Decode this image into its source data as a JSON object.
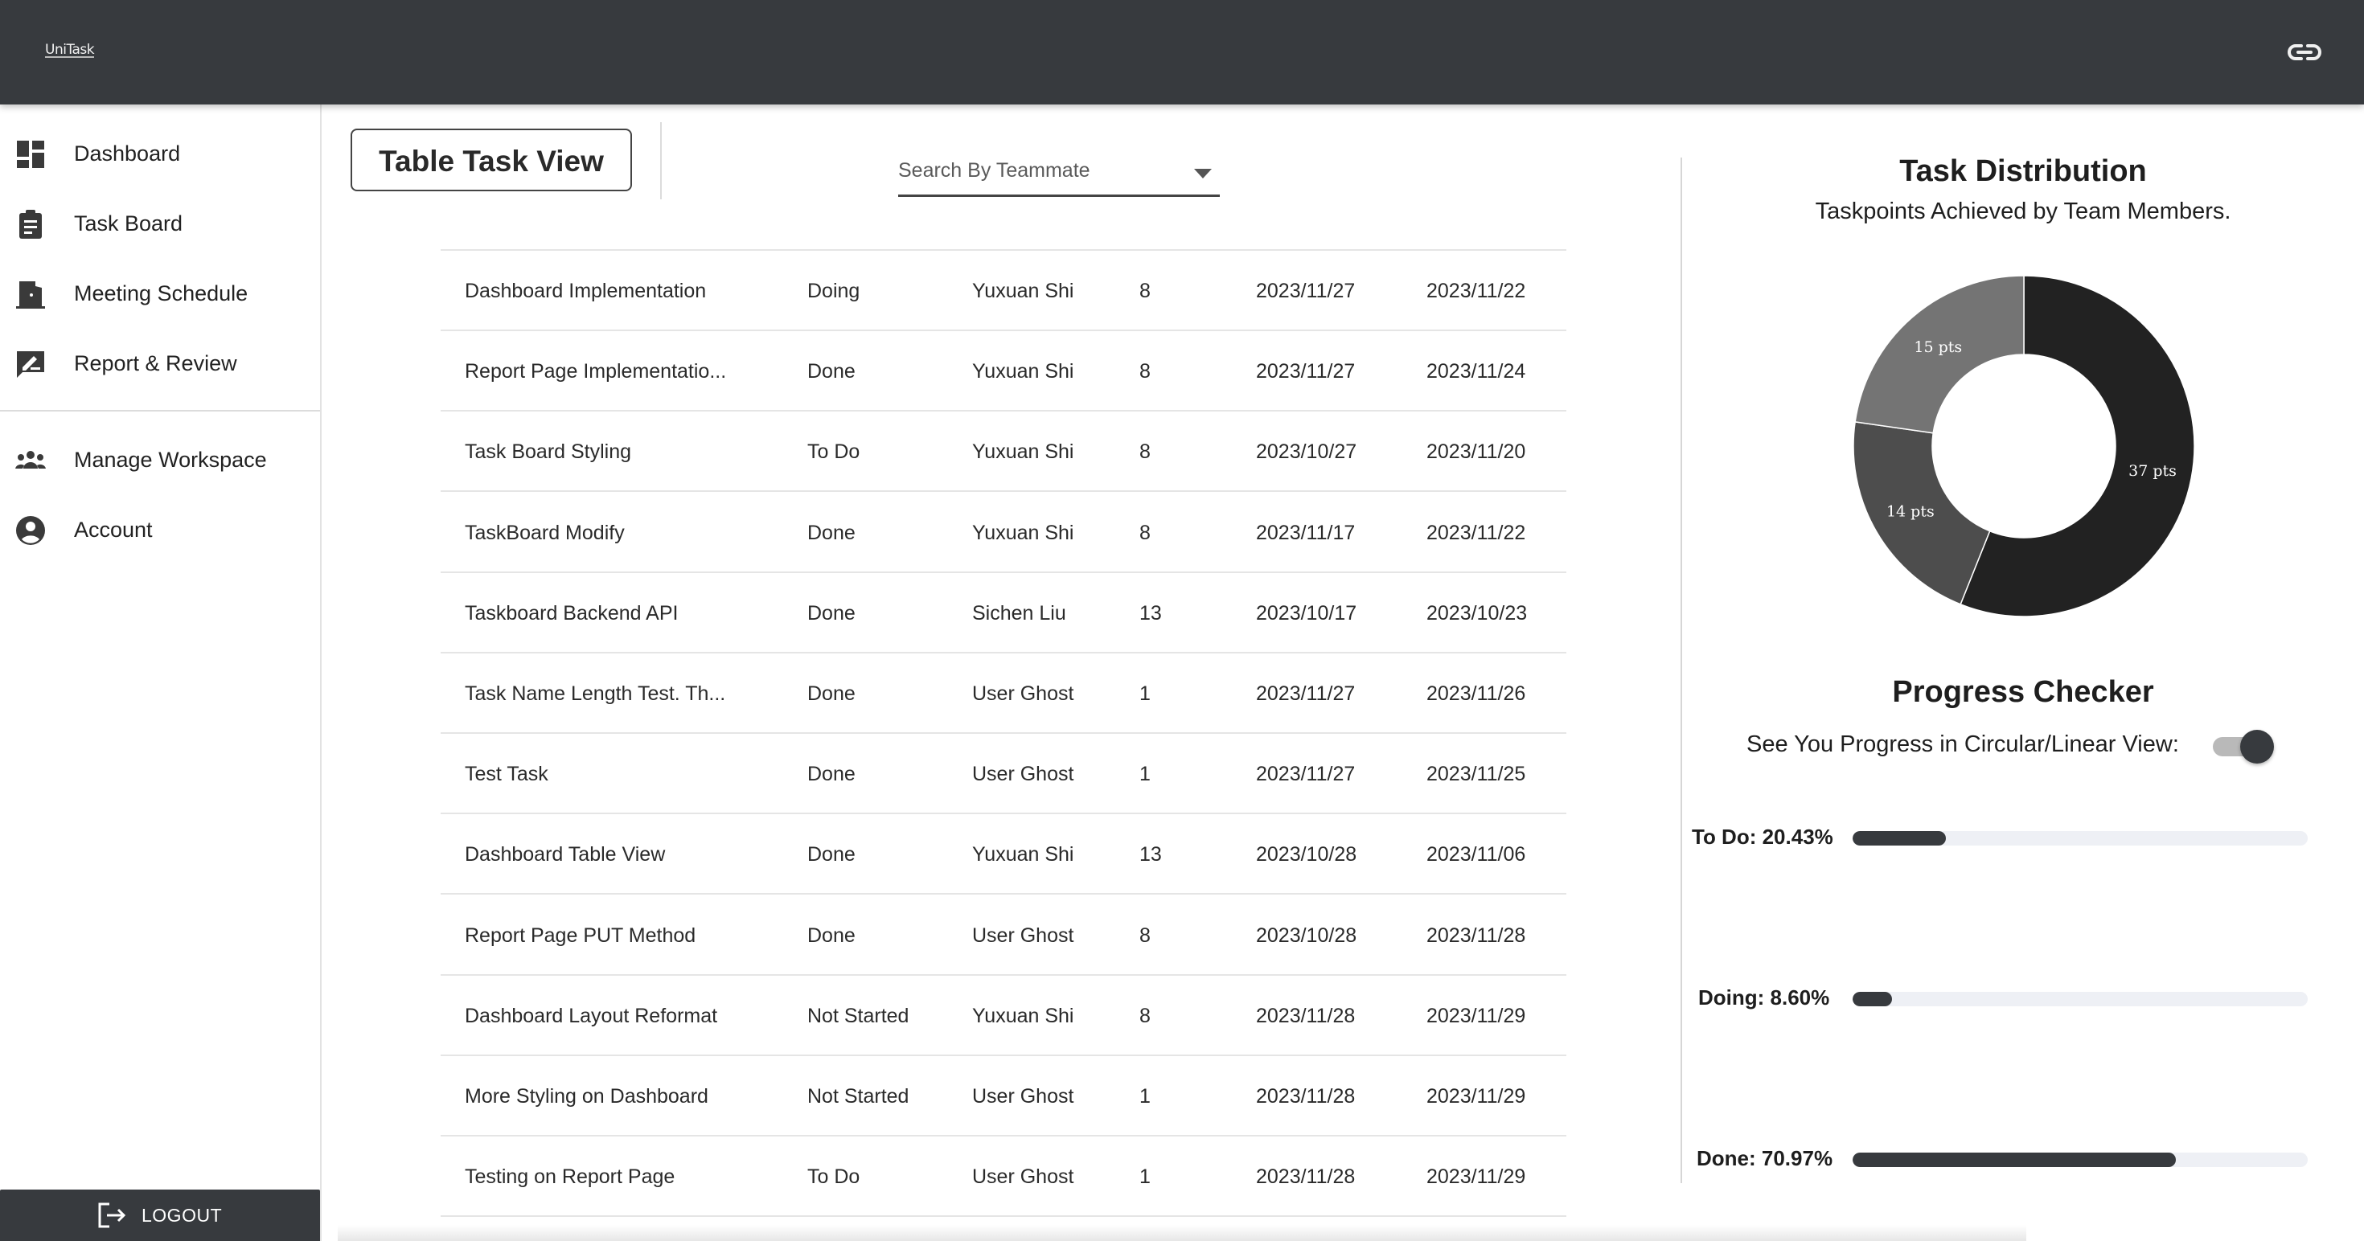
{
  "app": {
    "logo_text": "UniTask"
  },
  "sidebar": {
    "items": [
      {
        "label": "Dashboard",
        "icon": "dashboard-icon"
      },
      {
        "label": "Task Board",
        "icon": "clipboard-icon"
      },
      {
        "label": "Meeting Schedule",
        "icon": "door-icon"
      },
      {
        "label": "Report & Review",
        "icon": "rate-review-icon"
      },
      {
        "label": "Manage Workspace",
        "icon": "group-icon"
      },
      {
        "label": "Account",
        "icon": "account-circle-icon"
      }
    ],
    "logout_label": "LOGOUT"
  },
  "header": {
    "view_title": "Table Task View",
    "search_placeholder": "Search By Teammate"
  },
  "table": {
    "rows": [
      {
        "name": "Dashboard Implementation",
        "status": "Doing",
        "owner": "Yuxuan Shi",
        "points": "8",
        "due": "2023/11/27",
        "start": "2023/11/22"
      },
      {
        "name": "Report Page Implementatio...",
        "status": "Done",
        "owner": "Yuxuan Shi",
        "points": "8",
        "due": "2023/11/27",
        "start": "2023/11/24"
      },
      {
        "name": "Task Board Styling",
        "status": "To Do",
        "owner": "Yuxuan Shi",
        "points": "8",
        "due": "2023/10/27",
        "start": "2023/11/20"
      },
      {
        "name": "TaskBoard Modify",
        "status": "Done",
        "owner": "Yuxuan Shi",
        "points": "8",
        "due": "2023/11/17",
        "start": "2023/11/22"
      },
      {
        "name": "Taskboard Backend API",
        "status": "Done",
        "owner": "Sichen Liu",
        "points": "13",
        "due": "2023/10/17",
        "start": "2023/10/23"
      },
      {
        "name": "Task Name Length Test. Th...",
        "status": "Done",
        "owner": "User Ghost",
        "points": "1",
        "due": "2023/11/27",
        "start": "2023/11/26"
      },
      {
        "name": "Test Task",
        "status": "Done",
        "owner": "User Ghost",
        "points": "1",
        "due": "2023/11/27",
        "start": "2023/11/25"
      },
      {
        "name": "Dashboard Table View",
        "status": "Done",
        "owner": "Yuxuan Shi",
        "points": "13",
        "due": "2023/10/28",
        "start": "2023/11/06"
      },
      {
        "name": "Report Page PUT Method",
        "status": "Done",
        "owner": "User Ghost",
        "points": "8",
        "due": "2023/10/28",
        "start": "2023/11/28"
      },
      {
        "name": "Dashboard Layout Reformat",
        "status": "Not Started",
        "owner": "Yuxuan Shi",
        "points": "8",
        "due": "2023/11/28",
        "start": "2023/11/29"
      },
      {
        "name": "More Styling on Dashboard",
        "status": "Not Started",
        "owner": "User Ghost",
        "points": "1",
        "due": "2023/11/28",
        "start": "2023/11/29"
      },
      {
        "name": "Testing on Report Page",
        "status": "To Do",
        "owner": "User Ghost",
        "points": "1",
        "due": "2023/11/28",
        "start": "2023/11/29"
      }
    ]
  },
  "distribution": {
    "title": "Task Distribution",
    "subtitle": "Taskpoints Achieved by Team Members.",
    "slices": [
      {
        "label": "37 pts",
        "value": 37,
        "color": "#222222"
      },
      {
        "label": "14 pts",
        "value": 14,
        "color": "#4d4d4d"
      },
      {
        "label": "15 pts",
        "value": 15,
        "color": "#747474"
      }
    ]
  },
  "progress": {
    "title": "Progress Checker",
    "toggle_label": "See You Progress in Circular/Linear View:",
    "toggle_on": true,
    "items": [
      {
        "label": "To Do: 20.43%",
        "fraction": 0.2043
      },
      {
        "label": "Doing: 8.60%",
        "fraction": 0.086
      },
      {
        "label": "Done: 70.97%",
        "fraction": 0.7097
      }
    ]
  },
  "colors": {
    "topbar": "#373a3e",
    "accent_dark": "#373a3e",
    "track": "#eef0f5"
  }
}
